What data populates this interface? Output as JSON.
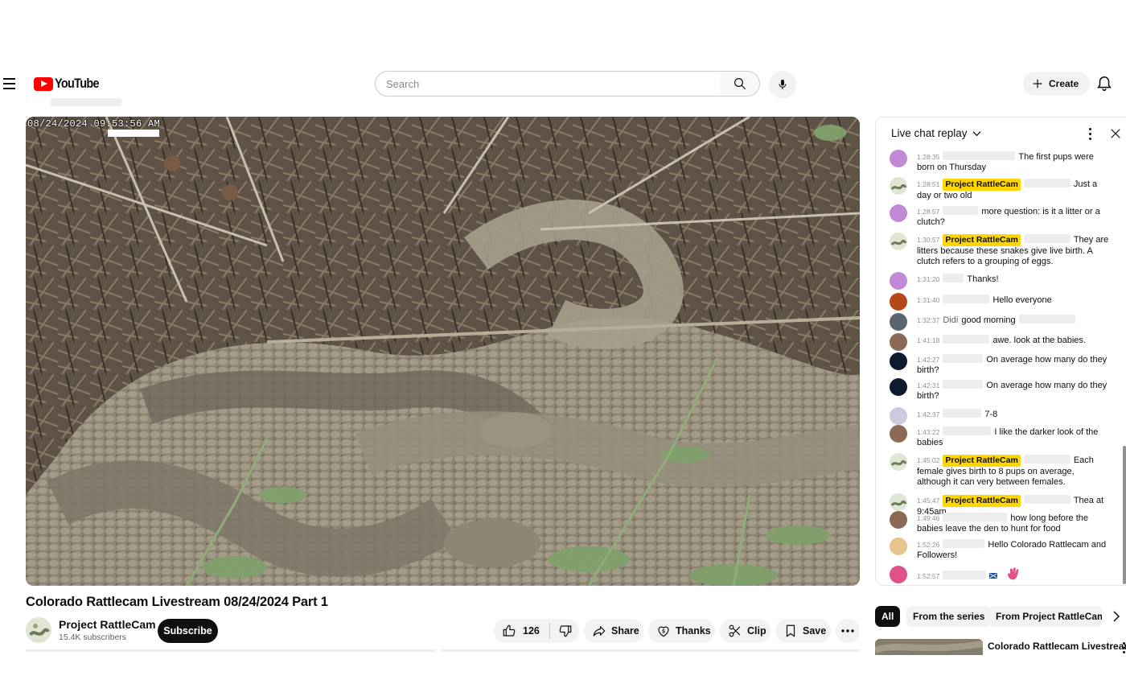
{
  "masthead": {
    "logo_text": "YouTube",
    "search_placeholder": "Search",
    "create_label": "Create"
  },
  "video": {
    "overlay_timestamp": "08/24/2024 09:53:56 AM",
    "title": "Colorado Rattlecam Livestream 08/24/2024 Part 1"
  },
  "channel": {
    "name": "Project RattleCam",
    "subscribers": "15.4K subscribers",
    "subscribe_label": "Subscribe"
  },
  "actions": {
    "like_count": "126",
    "share_label": "Share",
    "thanks_label": "Thanks",
    "clip_label": "Clip",
    "save_label": "Save"
  },
  "chat": {
    "title": "Live chat replay",
    "messages": [
      {
        "time": "1:28:35",
        "text": "The first pups were born on Thursday",
        "avatar": "#c08ad8",
        "owner": false
      },
      {
        "time": "1:28:51",
        "text": "Just a day or two old",
        "avatar": "owner",
        "owner": true
      },
      {
        "time": "1:28:57",
        "text": "more question: is it a litter or a clutch?",
        "avatar": "#c08ad8",
        "owner": false
      },
      {
        "time": "1:30:57",
        "text": "They are litters because these snakes give live birth. A clutch refers to a grouping of eggs.",
        "avatar": "owner",
        "owner": true
      },
      {
        "time": "1:31:20",
        "text": "Thanks!",
        "avatar": "#c08ad8",
        "owner": false
      },
      {
        "time": "1:31:40",
        "text": "Hello everyone",
        "avatar": "#b5481a",
        "owner": false
      },
      {
        "time": "1:32:37",
        "author": "Didi",
        "text": "good morning",
        "avatar": "#5b6570",
        "owner": false
      },
      {
        "time": "1:41:18",
        "text": "awe. look at the babies.",
        "avatar": "#8a6a55",
        "owner": false
      },
      {
        "time": "1:42:27",
        "text": "On average how many do they birth?",
        "avatar": "#0e1a2e",
        "owner": false
      },
      {
        "time": "1:42:31",
        "text": "On average how many do they birth?",
        "avatar": "#0e1a2e",
        "owner": false
      },
      {
        "time": "1:42:37",
        "text": "7-8",
        "avatar": "#cfc9e0",
        "owner": false
      },
      {
        "time": "1:43:22",
        "text": "I like the darker look of the babies",
        "avatar": "#8a6a55",
        "owner": false
      },
      {
        "time": "1:45:02",
        "text": "Each female gives birth to 8 pups on average, although it can very between females.",
        "avatar": "owner",
        "owner": true
      },
      {
        "time": "1:45:47",
        "text": "Thea at 9:45am",
        "avatar": "owner",
        "owner": true
      },
      {
        "time": "1:49:46",
        "text": "how long before the babies leave the den to hunt for food",
        "avatar": "#8a6a55",
        "owner": false
      },
      {
        "time": "1:52:26",
        "text": "Hello Colorado Rattlecam and Followers!",
        "avatar": "#e8c48e",
        "owner": false
      },
      {
        "time": "1:52:57",
        "text": "",
        "avatar": "#e0508a",
        "owner": false,
        "emoji": true
      }
    ]
  },
  "chips": [
    "All",
    "From the series",
    "From Project RattleCam"
  ],
  "recommendation": {
    "title": "Colorado Rattlecam Livestream"
  },
  "colors": {
    "brand_red": "#ff0000",
    "owner_badge": "#ffd600"
  }
}
